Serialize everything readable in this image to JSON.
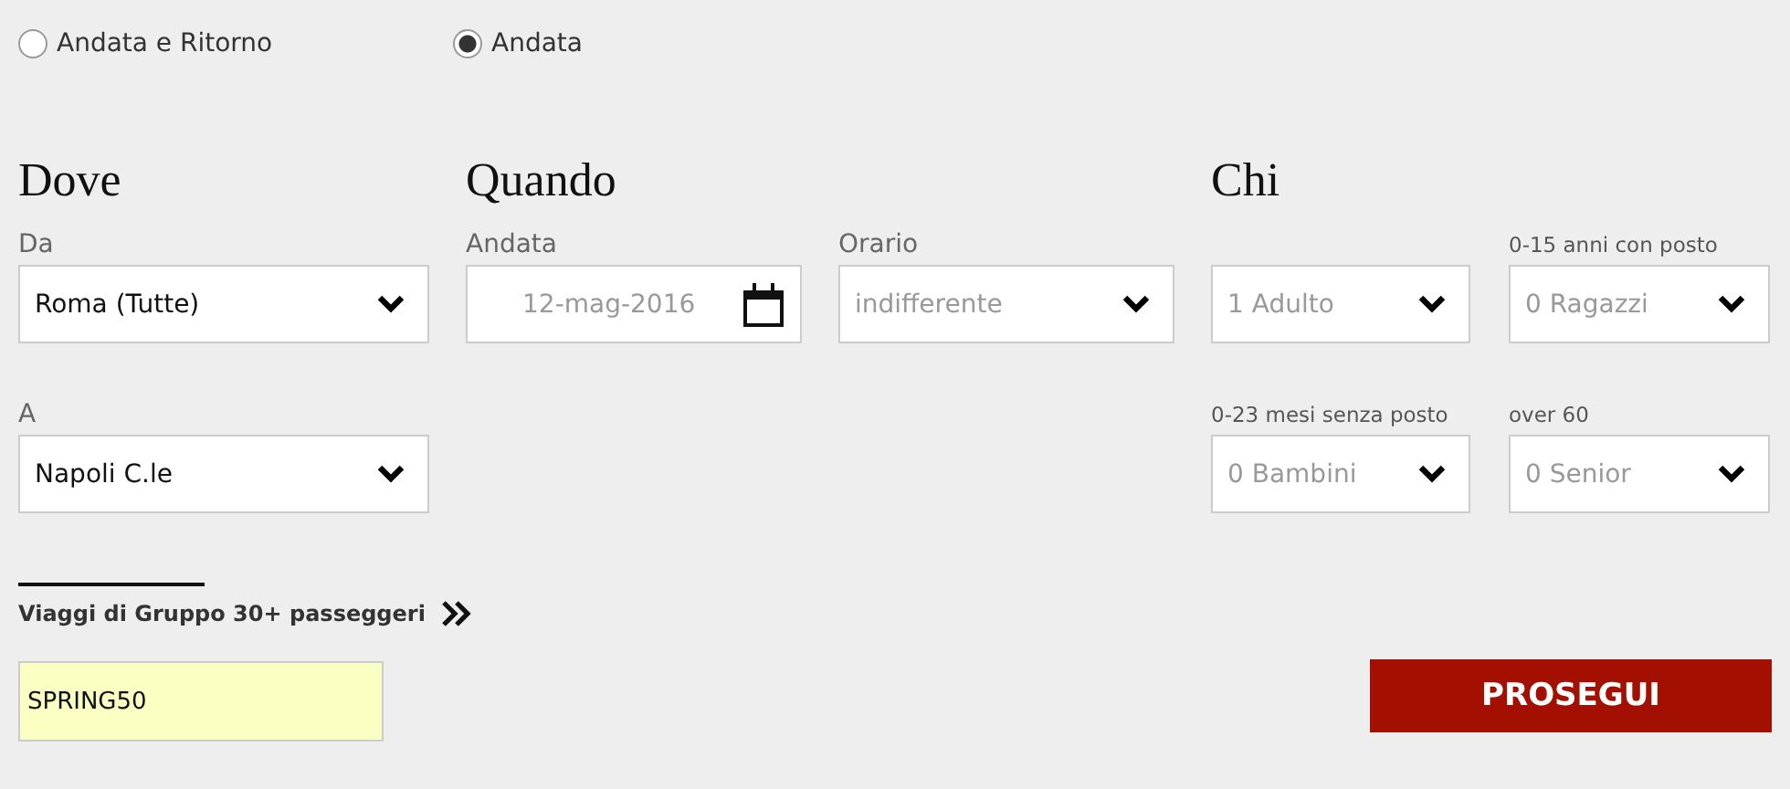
{
  "trip_type": [
    {
      "label": "Andata e Ritorno",
      "selected": false
    },
    {
      "label": "Andata",
      "selected": true
    }
  ],
  "dove": {
    "heading": "Dove",
    "fields": [
      {
        "kind": "select",
        "label": "Da",
        "value": "Roma (Tutte)",
        "default": false
      },
      {
        "kind": "select",
        "label": "A",
        "value": "Napoli C.le",
        "default": false
      }
    ]
  },
  "quando": {
    "heading": "Quando",
    "fields": [
      {
        "kind": "date",
        "label": "Andata",
        "value": "12-mag-2016",
        "default": true
      },
      {
        "kind": "select",
        "label": "Orario",
        "value": "indifferente",
        "default": true
      }
    ]
  },
  "chi": {
    "heading": "Chi",
    "fields": [
      {
        "kind": "select",
        "value": "1 Adulto",
        "default": true
      },
      {
        "kind": "select",
        "label": "0-15 anni con posto",
        "value": "0 Ragazzi",
        "default": true
      },
      {
        "kind": "select",
        "label": "0-23 mesi senza posto",
        "value": "0 Bambini",
        "default": true
      },
      {
        "kind": "select",
        "label": "over 60",
        "value": "0 Senior",
        "default": true
      }
    ]
  },
  "group_link": "Viaggi di Gruppo 30+ passeggeri",
  "promo_code": {
    "value": "SPRING50"
  },
  "submit_button": "PROSEGUI"
}
